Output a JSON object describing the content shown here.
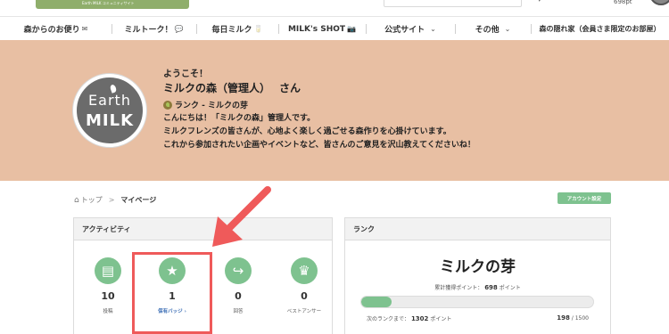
{
  "header": {
    "logo_tagline": "Earth MILK コミュニティサイト",
    "points_text": "698pt",
    "caret": "▾"
  },
  "nav": {
    "items": [
      {
        "label": "森からのお便り",
        "icon": "✉"
      },
      {
        "label": "ミルトーク！",
        "icon": "💬"
      },
      {
        "label": "毎日ミルク",
        "icon": "🥛"
      },
      {
        "label": "MILK's SHOT",
        "icon": "📷"
      },
      {
        "label": "公式サイト",
        "icon": "⌄"
      },
      {
        "label": "その他",
        "icon": "⌄"
      },
      {
        "label": "森の隠れ家（会員さま限定のお部屋）",
        "icon": ""
      }
    ]
  },
  "welcome": {
    "emblem_line1": "Earth",
    "emblem_line2": "MILK",
    "greeting": "ようこそ！",
    "user_name": "ミルクの森（管理人）",
    "name_suffix": "さん",
    "rank_line": "ランク - ミルクの芽",
    "message_lines": [
      "こんにちは！「ミルクの森」管理人です。",
      "ミルクフレンズの皆さんが、心地よく楽しく過ごせる森作りを心掛けています。",
      "これから参加されたい企画やイベントなど、皆さんのご意見を沢山教えてくださいね！"
    ]
  },
  "breadcrumb": {
    "home": "トップ",
    "separator": ">",
    "current": "マイページ"
  },
  "account_button": "アカウント設定",
  "activity": {
    "title": "アクティビティ",
    "stats": [
      {
        "icon": "post-icon",
        "glyph": "▤",
        "value": "10",
        "label": "投稿"
      },
      {
        "icon": "badge-icon",
        "glyph": "★",
        "value": "1",
        "label": "保有バッジ ›"
      },
      {
        "icon": "reply-icon",
        "glyph": "↪",
        "value": "0",
        "label": "回答"
      },
      {
        "icon": "crown-icon",
        "glyph": "♛",
        "value": "0",
        "label": "ベストアンサー"
      }
    ]
  },
  "rank": {
    "title": "ランク",
    "rank_name": "ミルクの芽",
    "points_prefix": "累計獲得ポイント：",
    "points_value": "698",
    "points_unit": "ポイント",
    "next_prefix": "次のランクまで：",
    "next_value": "1302",
    "next_unit": "ポイント",
    "progress_current": "198",
    "progress_total": "/ 1500",
    "progress_fraction": 0.132
  },
  "colors": {
    "accent_green": "#7ec28f",
    "welcome_bg": "#e8bfa3",
    "annotation_red": "#ef5a5a"
  }
}
